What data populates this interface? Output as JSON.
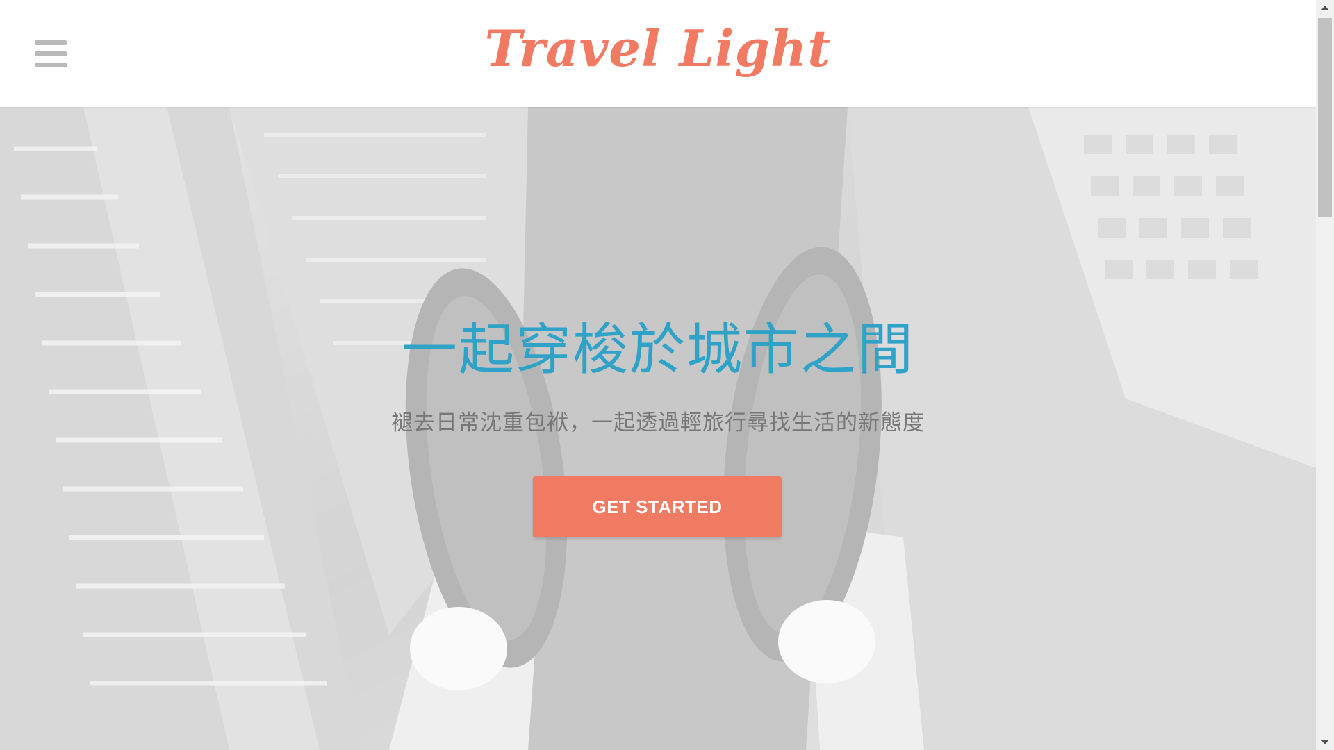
{
  "brand": {
    "logo_text": "Travel Light",
    "accent_color": "#f07b62"
  },
  "header": {
    "menu_icon": "hamburger-menu-icon"
  },
  "hero": {
    "title": "一起穿梭於城市之間",
    "title_color": "#2fa2c7",
    "subtitle": "褪去日常沈重包袱，一起透過輕旅行尋找生活的新態度",
    "cta_label": "GET STARTED",
    "cta_color": "#f07b62",
    "background_description_icon": "sneakers-over-city-photo"
  },
  "scrollbar": {
    "up_icon": "scroll-up-arrow-icon",
    "down_icon": "scroll-down-arrow-icon"
  }
}
